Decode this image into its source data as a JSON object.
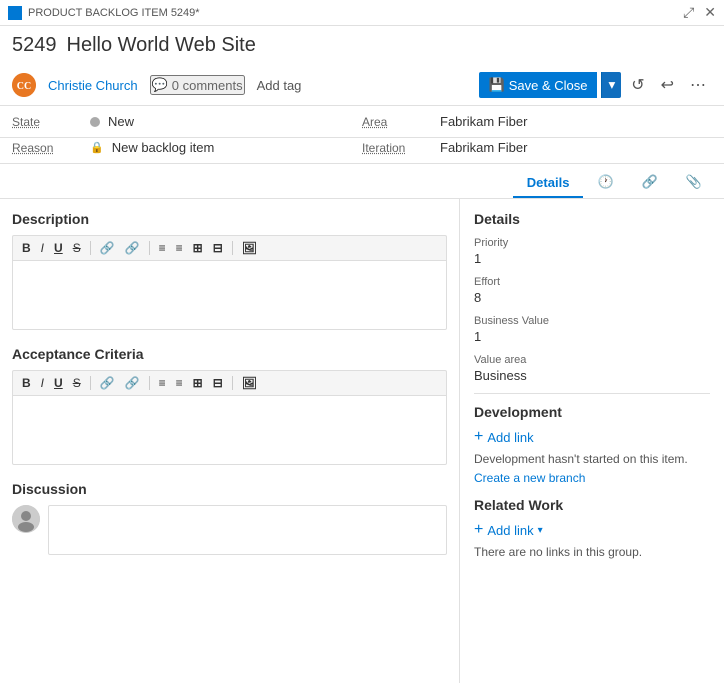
{
  "titleBar": {
    "icon": "blue-square",
    "label": "PRODUCT BACKLOG ITEM 5249*",
    "expandIcon": "⤢",
    "closeIcon": "✕"
  },
  "header": {
    "itemId": "5249",
    "itemTitle": "Hello World Web Site"
  },
  "user": {
    "name": "Christie Church",
    "avatarInitials": "CC"
  },
  "actions": {
    "commentsCount": "0 comments",
    "addTagLabel": "Add tag",
    "saveCloseLabel": "Save & Close",
    "refreshIcon": "↺",
    "undoIcon": "↩",
    "moreIcon": "⋯"
  },
  "meta": {
    "stateLabel": "State",
    "stateValue": "New",
    "reasonLabel": "Reason",
    "reasonValue": "New backlog item",
    "areaLabel": "Area",
    "areaValue": "Fabrikam Fiber",
    "iterationLabel": "Iteration",
    "iterationValue": "Fabrikam Fiber"
  },
  "tabs": [
    {
      "id": "details",
      "label": "Details",
      "active": true
    },
    {
      "id": "history",
      "label": "",
      "icon": "🕐"
    },
    {
      "id": "links",
      "label": "",
      "icon": "🔗"
    },
    {
      "id": "attachments",
      "label": "",
      "icon": "📎"
    }
  ],
  "leftPanel": {
    "descriptionSection": {
      "title": "Description",
      "toolbar": [
        "B",
        "I",
        "U",
        "S",
        "🔗",
        "🔗",
        "≡",
        "≡",
        "⊞",
        "⊟",
        "🖼"
      ]
    },
    "acceptanceCriteriaSection": {
      "title": "Acceptance Criteria",
      "toolbar": [
        "B",
        "I",
        "U",
        "S",
        "🔗",
        "🔗",
        "≡",
        "≡",
        "⊞",
        "⊟",
        "🖼"
      ]
    },
    "discussionSection": {
      "title": "Discussion",
      "inputPlaceholder": ""
    }
  },
  "rightPanel": {
    "heading": "Details",
    "fields": [
      {
        "label": "Priority",
        "value": "1"
      },
      {
        "label": "Effort",
        "value": "8"
      },
      {
        "label": "Business Value",
        "value": "1"
      },
      {
        "label": "Value area",
        "value": "Business"
      }
    ],
    "development": {
      "heading": "Development",
      "addLinkLabel": "Add link",
      "description": "Development hasn't started on this item.",
      "createBranchLabel": "Create a new branch"
    },
    "relatedWork": {
      "heading": "Related Work",
      "addLinkLabel": "Add link",
      "noLinksText": "There are no links in this group."
    }
  }
}
